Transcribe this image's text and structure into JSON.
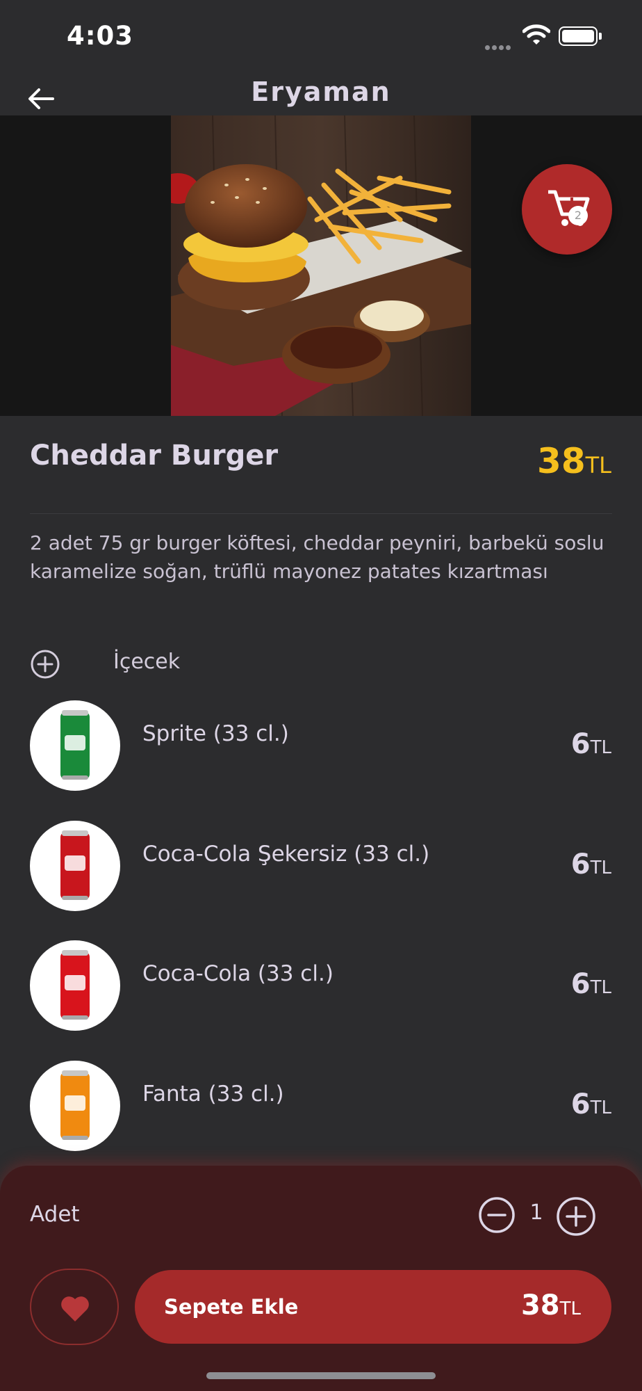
{
  "status_bar": {
    "time": "4:03"
  },
  "header": {
    "title": "Eryaman"
  },
  "cart": {
    "count": "2"
  },
  "product": {
    "name": "Cheddar Burger",
    "price": "38",
    "currency": "TL",
    "description": "2 adet 75 gr burger köftesi, cheddar peyniri, barbekü soslu karamelize soğan, trüflü mayonez patates kızartması"
  },
  "section": {
    "title": "İçecek"
  },
  "drinks": [
    {
      "name": "Sprite (33 cl.)",
      "price": "6",
      "currency": "TL",
      "color": "#1a8a3a"
    },
    {
      "name": "Coca-Cola Şekersiz (33 cl.)",
      "price": "6",
      "currency": "TL",
      "color": "#c8161d"
    },
    {
      "name": "Coca-Cola (33 cl.)",
      "price": "6",
      "currency": "TL",
      "color": "#d8141c"
    },
    {
      "name": "Fanta (33 cl.)",
      "price": "6",
      "currency": "TL",
      "color": "#f08a10"
    }
  ],
  "order": {
    "qty_label": "Adet",
    "qty": "1",
    "add_label": "Sepete Ekle",
    "total": "38",
    "currency": "TL"
  },
  "colors": {
    "accent": "#a52a2a",
    "price": "#f5bf1d",
    "background": "#2c2c2e"
  }
}
